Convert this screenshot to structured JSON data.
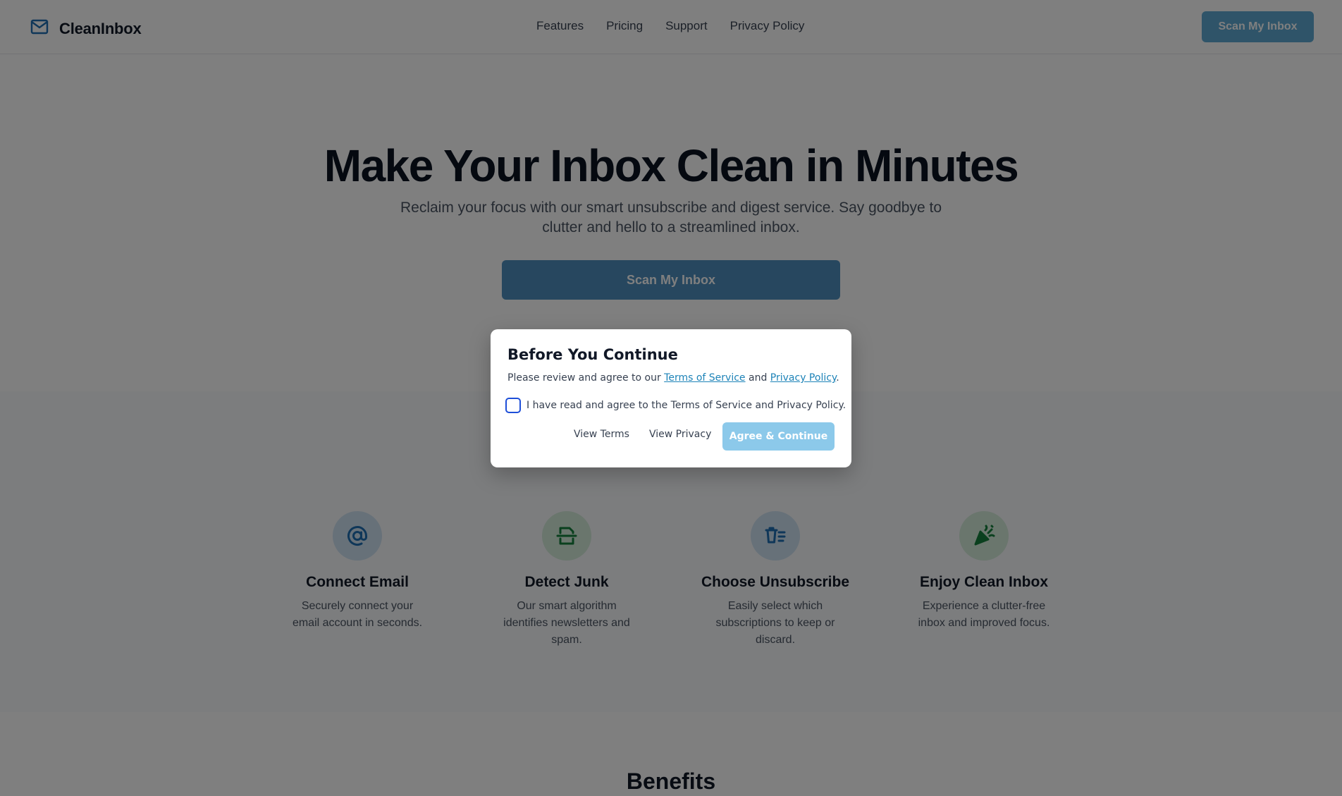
{
  "header": {
    "logo_text": "CleanInbox",
    "nav": [
      "Features",
      "Pricing",
      "Support",
      "Privacy Policy"
    ],
    "cta_label": "Scan My Inbox"
  },
  "hero": {
    "title": "Make Your Inbox Clean in Minutes",
    "subtitle": "Reclaim your focus with our smart unsubscribe and digest service. Say goodbye to clutter and hello to a streamlined inbox.",
    "cta_label": "Scan My Inbox"
  },
  "steps": [
    {
      "icon": "at-sign-icon",
      "title": "Connect Email",
      "description": "Securely connect your email account in seconds."
    },
    {
      "icon": "filter-icon",
      "title": "Detect Junk",
      "description": "Our smart algorithm identifies newsletters and spam."
    },
    {
      "icon": "trash-list-icon",
      "title": "Choose Unsubscribe",
      "description": "Easily select which subscriptions to keep or discard."
    },
    {
      "icon": "party-popper-icon",
      "title": "Enjoy Clean Inbox",
      "description": "Experience a clutter-free inbox and improved focus."
    }
  ],
  "benefits_title": "Benefits",
  "modal": {
    "title": "Before You Continue",
    "text_prefix": "Please review and agree to our ",
    "terms_link": "Terms of Service",
    "text_and": " and ",
    "privacy_link": "Privacy Policy",
    "text_suffix": ".",
    "checkbox_label": "I have read and agree to the Terms of Service and Privacy Policy.",
    "checkbox_checked": false,
    "view_terms_label": "View Terms",
    "view_privacy_label": "View Privacy",
    "agree_label": "Agree & Continue"
  },
  "colors": {
    "primary": "#4f8fbe",
    "primary_light": "#5ea8d3",
    "agree_disabled": "#8cc9ea",
    "link": "#1d83b8",
    "icon_blue": "#1f6fb2",
    "icon_green": "#15803d",
    "overlay": "rgba(0,0,0,0.5)"
  }
}
